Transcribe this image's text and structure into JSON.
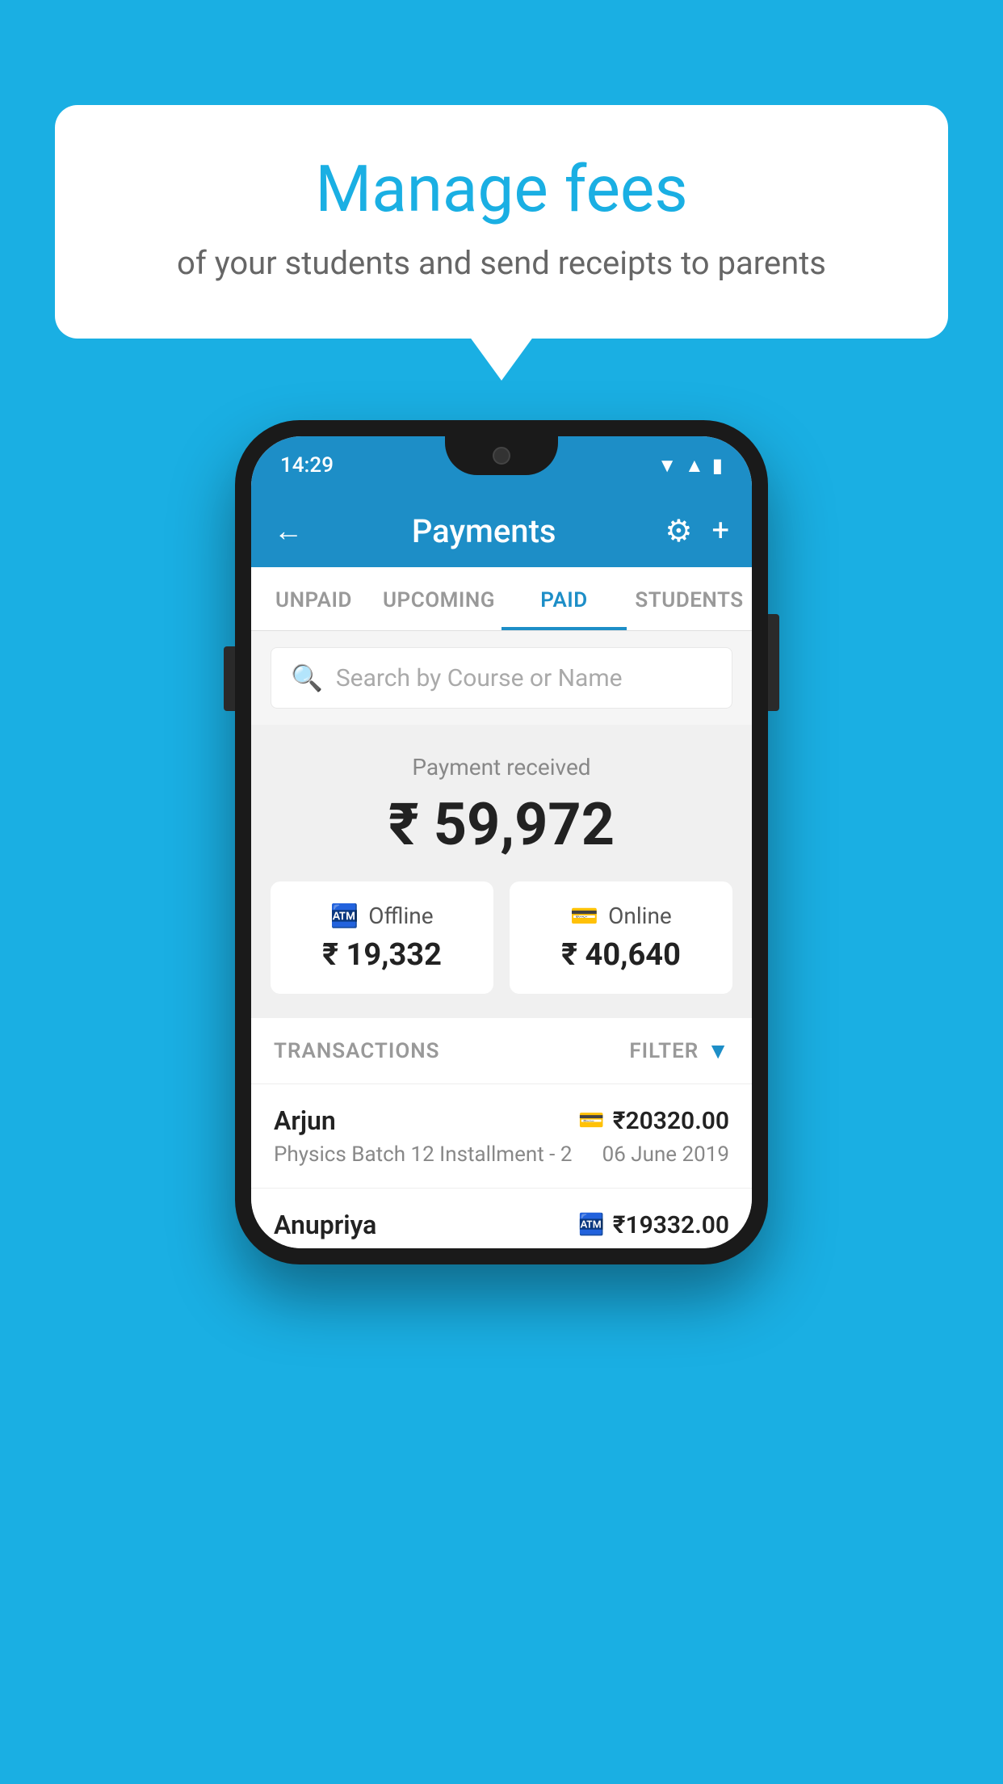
{
  "background": "#1AAFE3",
  "bubble": {
    "title": "Manage fees",
    "subtitle": "of your students and send receipts to parents"
  },
  "phone": {
    "status_bar": {
      "time": "14:29"
    },
    "header": {
      "title": "Payments",
      "back_label": "←",
      "gear_label": "⚙",
      "plus_label": "+"
    },
    "tabs": [
      {
        "label": "UNPAID",
        "active": false
      },
      {
        "label": "UPCOMING",
        "active": false
      },
      {
        "label": "PAID",
        "active": true
      },
      {
        "label": "STUDENTS",
        "active": false
      }
    ],
    "search": {
      "placeholder": "Search by Course or Name"
    },
    "payment_received": {
      "label": "Payment received",
      "amount": "₹ 59,972",
      "offline": {
        "type": "Offline",
        "amount": "₹ 19,332"
      },
      "online": {
        "type": "Online",
        "amount": "₹ 40,640"
      }
    },
    "transactions": {
      "header": "TRANSACTIONS",
      "filter": "FILTER",
      "rows": [
        {
          "name": "Arjun",
          "desc": "Physics Batch 12 Installment - 2",
          "amount": "₹20320.00",
          "date": "06 June 2019",
          "payment_type": "card"
        },
        {
          "name": "Anupriya",
          "amount": "₹19332.00",
          "payment_type": "offline"
        }
      ]
    }
  }
}
